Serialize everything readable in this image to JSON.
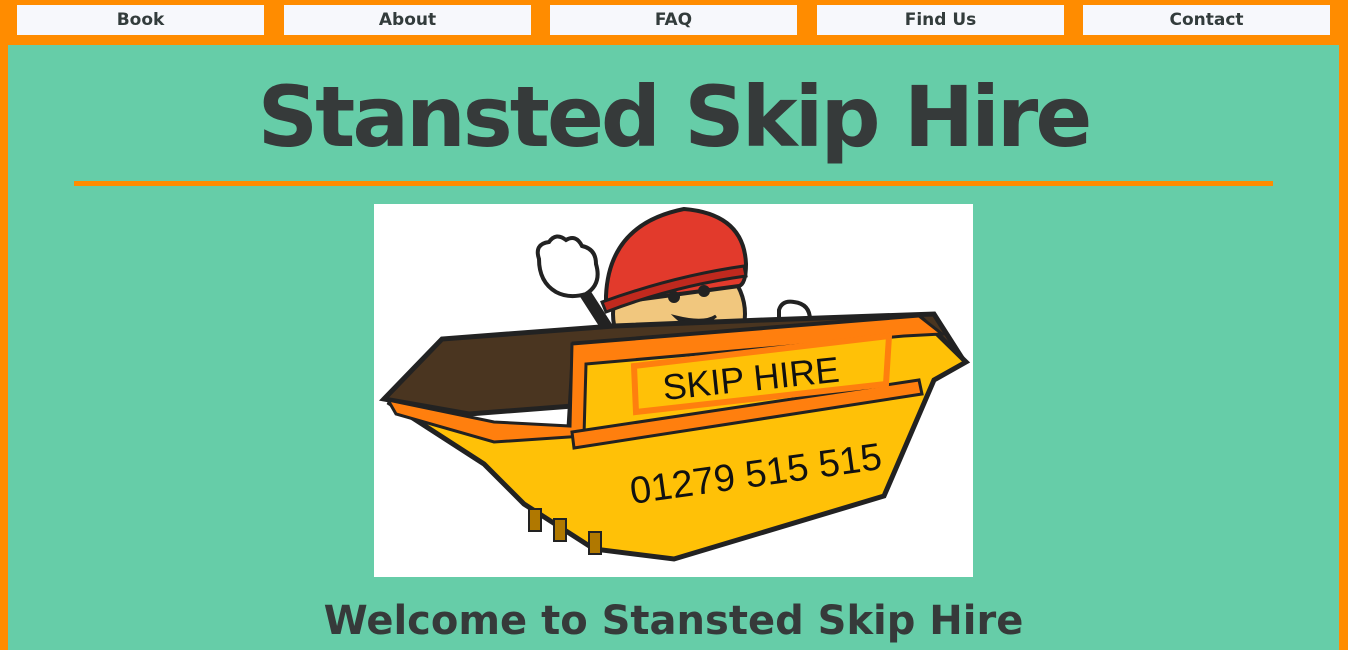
{
  "nav": {
    "items": [
      {
        "label": "Book"
      },
      {
        "label": "About"
      },
      {
        "label": "FAQ"
      },
      {
        "label": "Find Us"
      },
      {
        "label": "Contact"
      }
    ]
  },
  "header": {
    "title": "Stansted Skip Hire"
  },
  "logo": {
    "sign_text": "SKIP HIRE",
    "phone": "01279 515 515"
  },
  "main": {
    "welcome_heading": "Welcome to Stansted Skip Hire"
  },
  "colors": {
    "accent_orange": "#ff8c00",
    "background_green": "#66cda8",
    "text_dark": "#363a3a",
    "nav_button_bg": "#f7f8fc"
  }
}
